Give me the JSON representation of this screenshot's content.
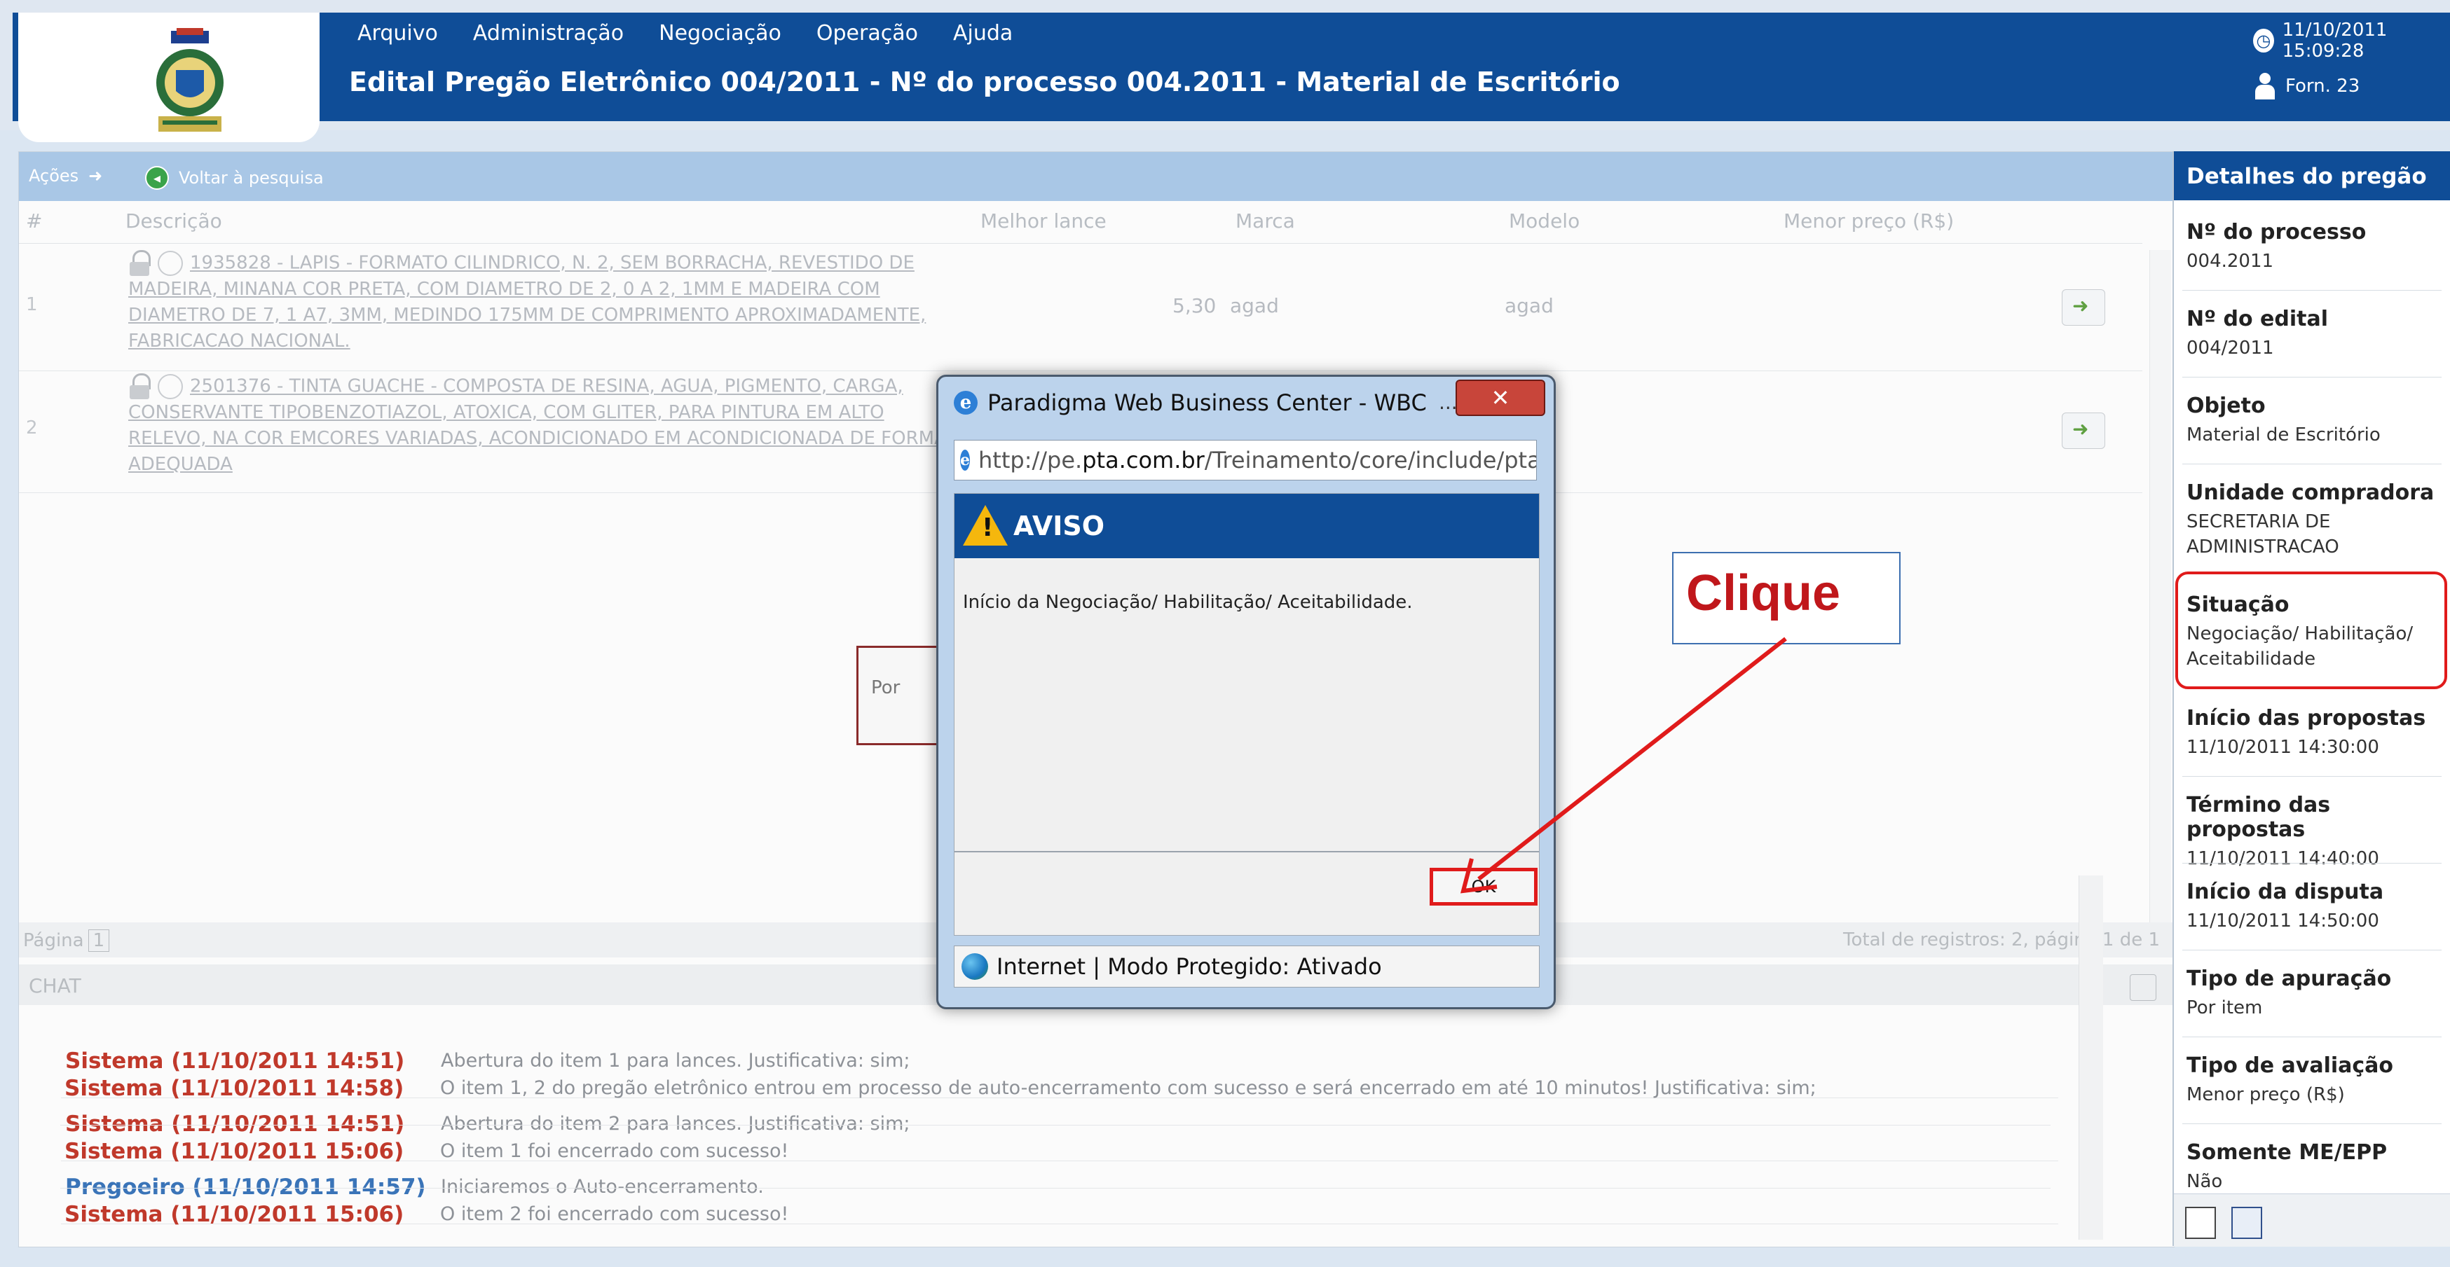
{
  "header": {
    "menu": [
      "Arquivo",
      "Administração",
      "Negociação",
      "Operação",
      "Ajuda"
    ],
    "title": "Edital Pregão Eletrônico 004/2011 - Nº do processo 004.2011 - Material de Escritório",
    "datetime": "11/10/2011 15:09:28",
    "user": "Forn. 23"
  },
  "actions": {
    "label": "Ações",
    "back": "Voltar à pesquisa"
  },
  "grid": {
    "headers": [
      "#",
      "Descrição",
      "Melhor lance",
      "Marca",
      "Modelo",
      "Menor preço (R$)"
    ],
    "rows": [
      {
        "num": "1",
        "desc": "1935828 - LAPIS - FORMATO CILINDRICO, N. 2, SEM BORRACHA, REVESTIDO DE MADEIRA, MINANA COR PRETA, COM DIAMETRO DE 2, 0 A 2, 1MM E MADEIRA COM DIAMETRO DE 7, 1 A7, 3MM, MEDINDO 175MM DE COMPRIMENTO APROXIMADAMENTE, FABRICACAO NACIONAL.",
        "lance": "5,30",
        "marca": "agad",
        "modelo": "agad"
      },
      {
        "num": "2",
        "desc": "2501376 - TINTA GUACHE - COMPOSTA DE RESINA, AGUA, PIGMENTO, CARGA, CONSERVANTE TIPOBENZOTIAZOL, ATOXICA, COM GLITER, PARA PINTURA EM ALTO RELEVO, NA COR EMCORES VARIADAS, ACONDICIONADO EM ACONDICIONADA DE FORMA ADEQUADA",
        "lance": "",
        "marca": "",
        "modelo": ""
      }
    ],
    "loading": "Por",
    "page_label": "Página",
    "page": "1",
    "total": "Total de registros: 2,  página  1  de  1"
  },
  "chat": {
    "title": "CHAT",
    "messages": [
      {
        "who": "Sistema (11/10/2011 14:51)",
        "msg": "Abertura do item 1 para lances. Justificativa: sim;",
        "color": "#c0392b"
      },
      {
        "who": "Sistema (11/10/2011 14:51)",
        "msg": "Abertura do item 2 para lances. Justificativa: sim;",
        "color": "#c0392b"
      },
      {
        "who": "Pregoeiro (11/10/2011 14:57)",
        "msg": "Iniciaremos o Auto-encerramento.",
        "color": "#3a74b8"
      },
      {
        "who": "Sistema (11/10/2011 14:58)",
        "msg": "O item 1, 2 do pregão eletrônico entrou em processo de auto-encerramento com sucesso e será encerrado em até 10 minutos! Justificativa: sim;",
        "color": "#c0392b"
      },
      {
        "who": "Sistema (11/10/2011 15:06)",
        "msg": "O item 1 foi encerrado com sucesso!",
        "color": "#c0392b"
      },
      {
        "who": "Sistema (11/10/2011 15:06)",
        "msg": "O item 2 foi encerrado com sucesso!",
        "color": "#c0392b"
      }
    ]
  },
  "side": {
    "title": "Detalhes do pregão",
    "fields": [
      {
        "label": "Nº do processo",
        "value": "004.2011"
      },
      {
        "label": "Nº do edital",
        "value": "004/2011"
      },
      {
        "label": "Objeto",
        "value": "Material de Escritório"
      },
      {
        "label": "Unidade compradora",
        "value": "SECRETARIA DE ADMINISTRACAO"
      },
      {
        "label": "Situação",
        "value": "Negociação/ Habilitação/ Aceitabilidade"
      },
      {
        "label": "Início das propostas",
        "value": "11/10/2011 14:30:00"
      },
      {
        "label": "Término das propostas",
        "value": "11/10/2011 14:40:00"
      },
      {
        "label": "Início da disputa",
        "value": "11/10/2011 14:50:00"
      },
      {
        "label": "Tipo de apuração",
        "value": "Por item"
      },
      {
        "label": "Tipo de avaliação",
        "value": "Menor preço (R$)"
      },
      {
        "label": "Somente ME/EPP",
        "value": "Não"
      }
    ]
  },
  "dialog": {
    "title": "Paradigma Web Business Center - WBC",
    "url_prefix": "http://pe.",
    "url_domain": "pta.com.br",
    "url_rest": "/Treinamento/core/include/pta_w",
    "heading": "AVISO",
    "message": "Início da Negociação/ Habilitação/ Aceitabilidade.",
    "ok": "OK",
    "status": "Internet | Modo Protegido: Ativado"
  },
  "annotation": {
    "text": "Clique"
  }
}
